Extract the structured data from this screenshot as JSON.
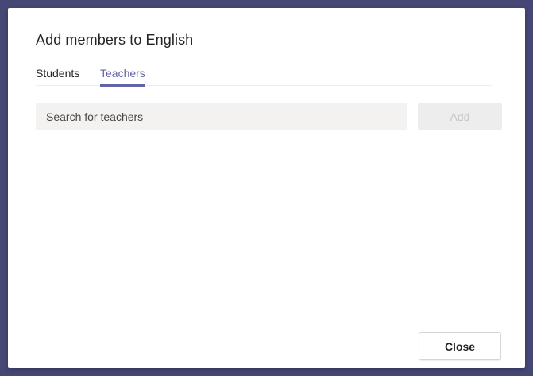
{
  "dialog": {
    "title": "Add members to English"
  },
  "tabs": [
    {
      "label": "Students",
      "selected": false
    },
    {
      "label": "Teachers",
      "selected": true
    }
  ],
  "search": {
    "value": "",
    "placeholder": "Search for teachers"
  },
  "buttons": {
    "add_label": "Add",
    "close_label": "Close"
  },
  "colors": {
    "background": "#464775",
    "accent": "#6264a7",
    "dialog": "#ffffff",
    "input_background": "#f3f2f1"
  }
}
